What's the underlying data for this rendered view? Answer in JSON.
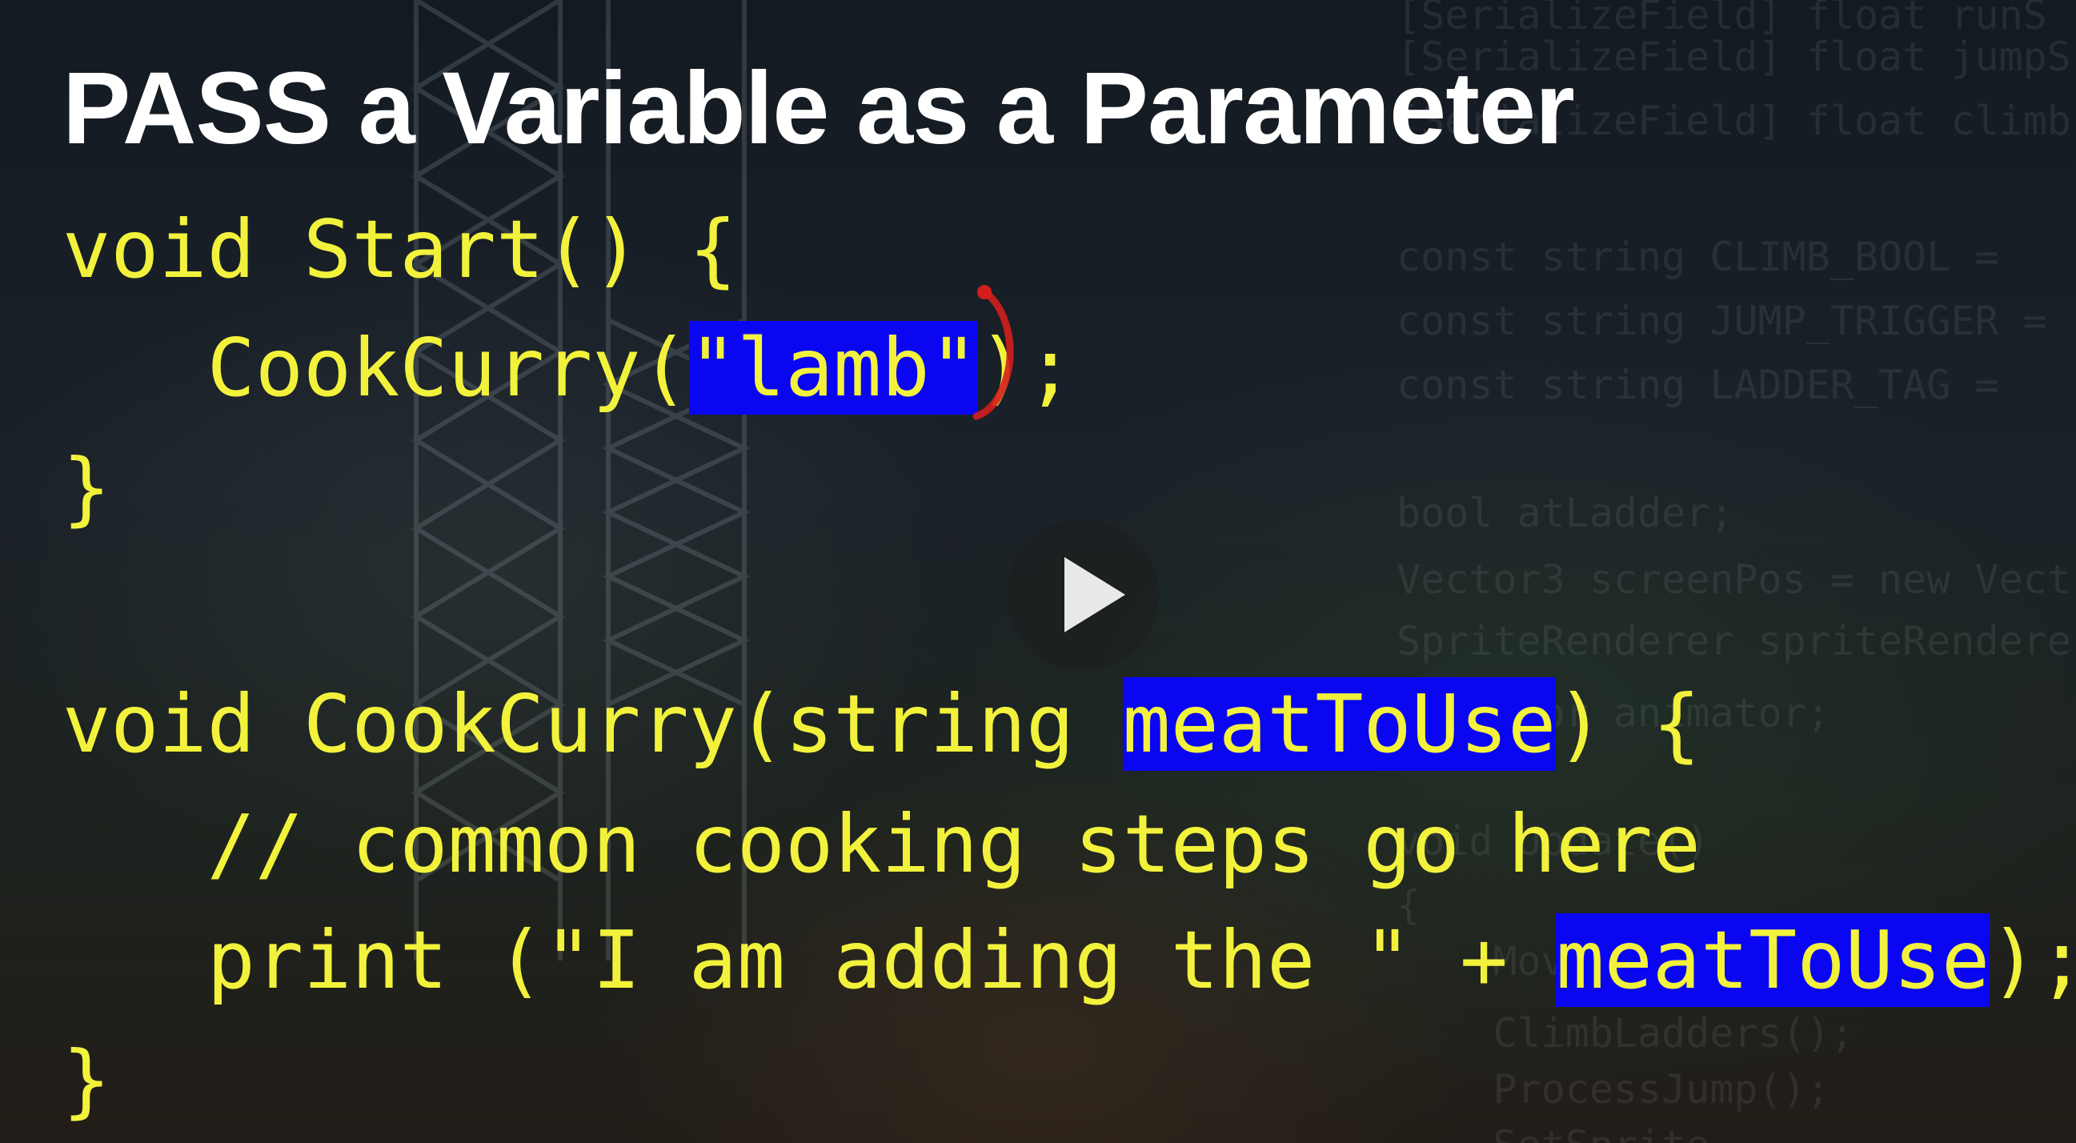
{
  "slide": {
    "title": "PASS a Variable as a Parameter"
  },
  "code": {
    "start_open": "void Start() {",
    "call_prefix": "   CookCurry(",
    "call_arg": "\"lamb\"",
    "call_suffix": ");",
    "start_close": "}",
    "func_prefix": "void CookCurry(string ",
    "func_param": "meatToUse",
    "func_suffix": ") {",
    "comment": "   // common cooking steps go here",
    "print_prefix": "   print (\"I am adding the \" + ",
    "print_var": "meatToUse",
    "print_suffix": ");",
    "func_close": "}"
  },
  "background_code": {
    "lines": [
      "[SerializeField] float runS",
      "[SerializeField] float jumpS",
      "[SerializeField] float climb",
      "const string CLIMB_BOOL =",
      "const string JUMP_TRIGGER =",
      "const string LADDER_TAG =",
      "bool atLadder;",
      "Vector3 screenPos = new Vect",
      "SpriteRenderer spriteRendere",
      "Animator animator;",
      "void Update()",
      "{",
      "    Move();",
      "    ClimbLadders();",
      "    ProcessJump();",
      "    SetSprite"
    ]
  },
  "player": {
    "play_icon": "play-icon"
  },
  "colors": {
    "code_text": "#f2f23c",
    "highlight": "#0a06f2",
    "title": "#ffffff",
    "pen_stroke": "#d41e1e"
  }
}
